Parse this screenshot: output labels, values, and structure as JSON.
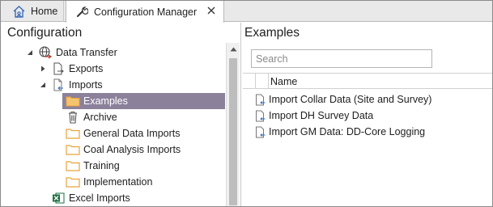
{
  "tabs": {
    "home_label": "Home",
    "active_label": "Configuration Manager"
  },
  "left_panel": {
    "title": "Configuration",
    "tree": {
      "data_transfer": "Data Transfer",
      "exports": "Exports",
      "imports": "Imports",
      "examples": "Examples",
      "archive": "Archive",
      "general_data_imports": "General Data Imports",
      "coal_analysis_imports": "Coal Analysis Imports",
      "training": "Training",
      "implementation": "Implementation",
      "excel_imports": "Excel Imports"
    }
  },
  "right_panel": {
    "title": "Examples",
    "search_placeholder": "Search",
    "column_name": "Name",
    "rows": [
      "Import Collar Data (Site and Survey)",
      "Import DH Survey Data",
      "Import GM Data: DD-Core Logging"
    ]
  },
  "colors": {
    "selection": "#8c819b",
    "folder": "#e8a33a",
    "excel": "#1d6f42"
  }
}
